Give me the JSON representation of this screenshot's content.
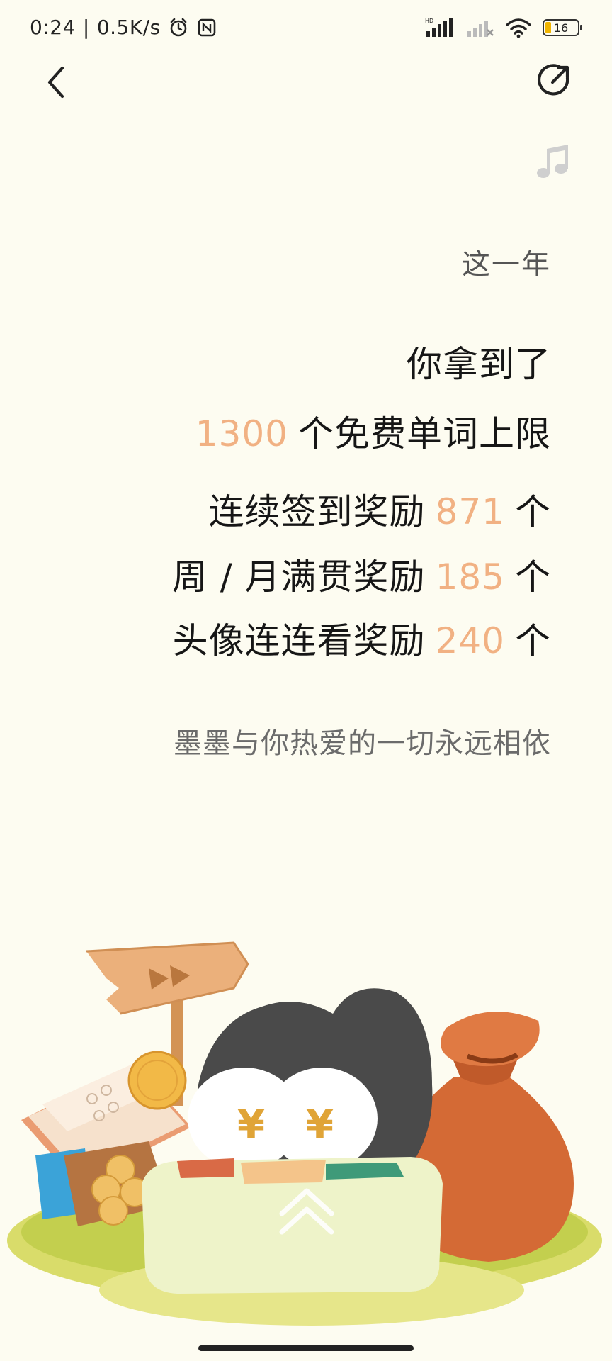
{
  "status_bar": {
    "time": "0:24",
    "speed": "0.5K/s",
    "battery_level": "16"
  },
  "header": {
    "back_icon": "chevron-left-icon",
    "share_icon": "share-icon",
    "music_icon": "music-note-icon"
  },
  "content": {
    "subtitle": "这一年",
    "line1": "你拿到了",
    "line2": {
      "value": "1300",
      "text": "个免费单词上限"
    },
    "line3": {
      "text": "连续签到奖励",
      "value": "871",
      "unit": "个"
    },
    "line4": {
      "text": "周 / 月满贯奖励",
      "value": "185",
      "unit": "个"
    },
    "line5": {
      "text": "头像连连看奖励",
      "value": "240",
      "unit": "个"
    },
    "footer": "墨墨与你热爱的一切永远相依"
  },
  "colors": {
    "background": "#fdfcf1",
    "accent_number": "#f1b183",
    "text_primary": "#161616",
    "text_secondary": "#6b6b6b"
  }
}
